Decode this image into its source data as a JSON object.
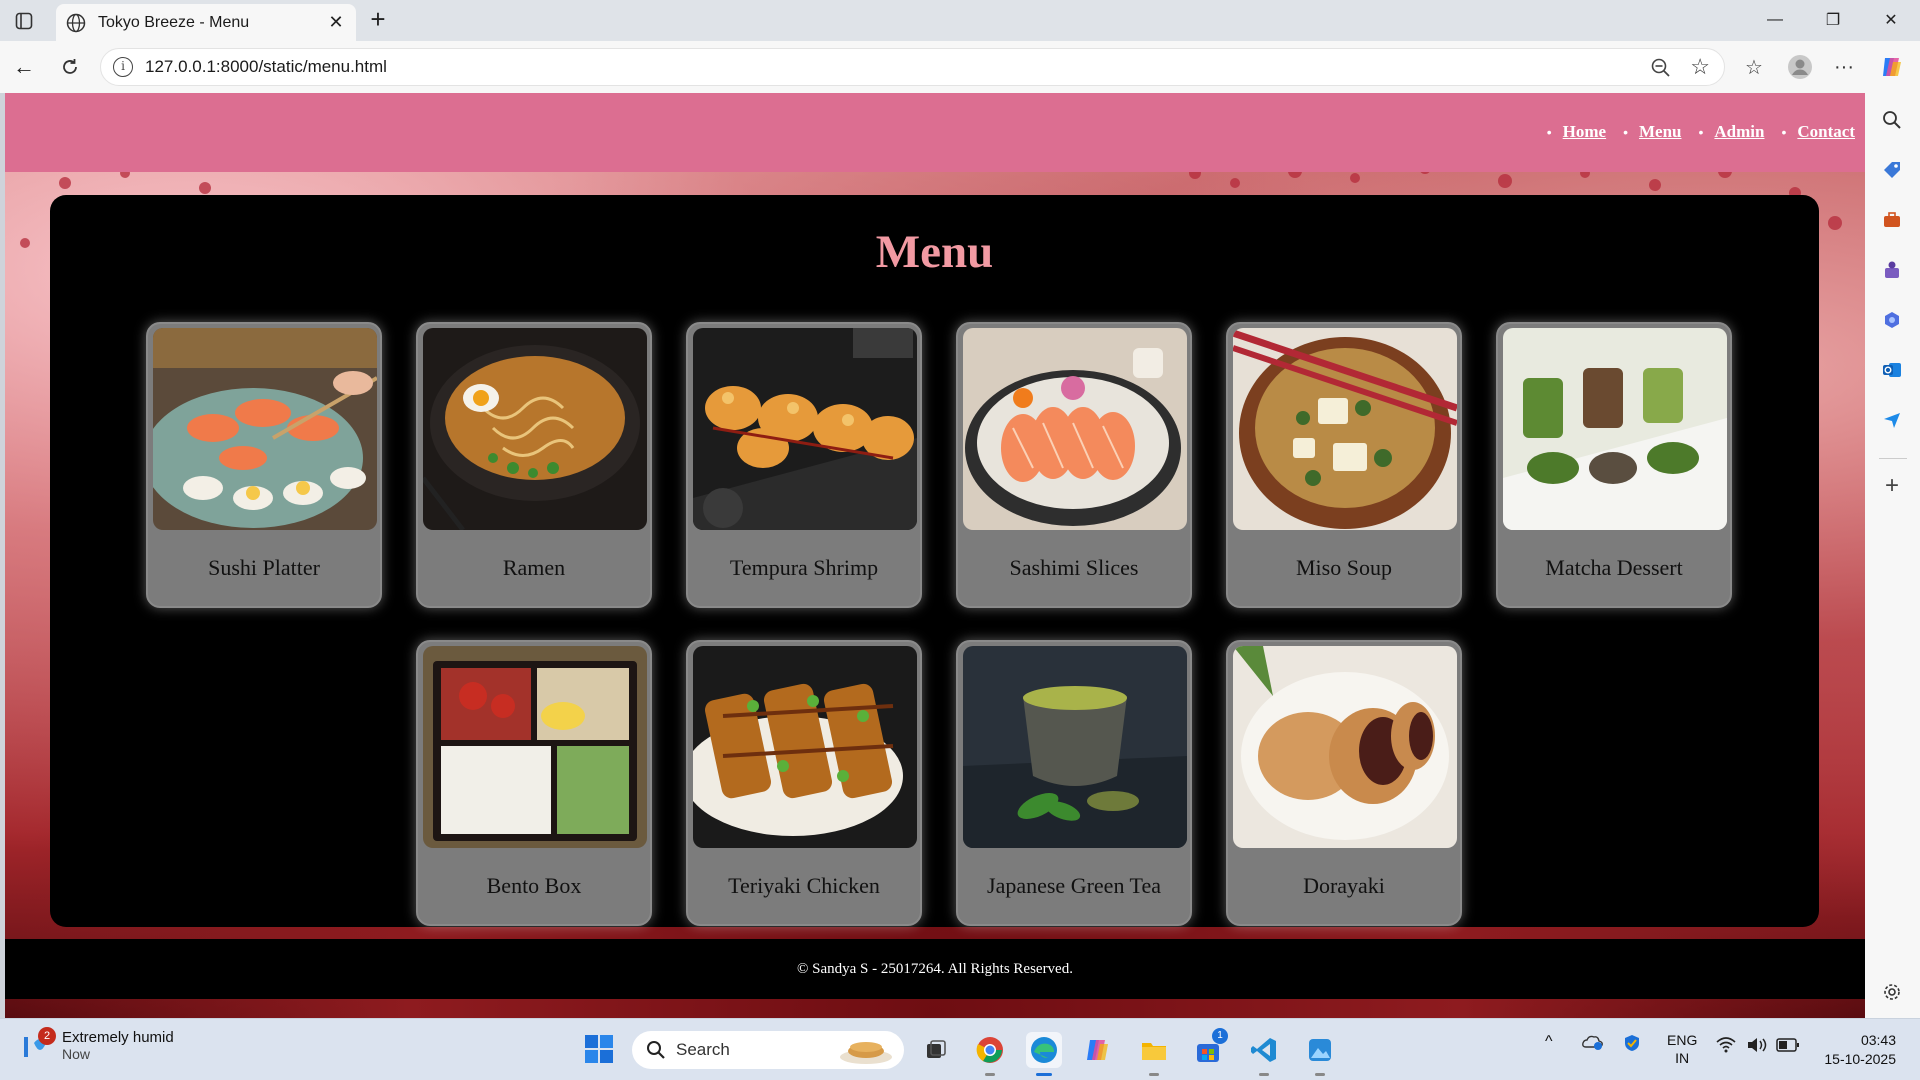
{
  "browser": {
    "tab_title": "Tokyo Breeze - Menu",
    "url": "127.0.0.1:8000/static/menu.html"
  },
  "site": {
    "nav": [
      "Home",
      "Menu",
      "Admin",
      "Contact"
    ],
    "title": "Menu",
    "items": [
      {
        "name": "Sushi Platter",
        "icon": "sushi-photo"
      },
      {
        "name": "Ramen",
        "icon": "ramen-photo"
      },
      {
        "name": "Tempura Shrimp",
        "icon": "tempura-photo"
      },
      {
        "name": "Sashimi Slices",
        "icon": "sashimi-photo"
      },
      {
        "name": "Miso Soup",
        "icon": "miso-photo"
      },
      {
        "name": "Matcha Dessert",
        "icon": "matcha-photo"
      },
      {
        "name": "Bento Box",
        "icon": "bento-photo"
      },
      {
        "name": "Teriyaki Chicken",
        "icon": "teriyaki-photo"
      },
      {
        "name": "Japanese Green Tea",
        "icon": "green-tea-photo"
      },
      {
        "name": "Dorayaki",
        "icon": "dorayaki-photo"
      }
    ],
    "footer": "© Sandya S - 25017264. All Rights Reserved.",
    "colors": {
      "header": "#dc6e91",
      "title": "#f29aa3",
      "panel": "#000000",
      "card": "#7c7c7c"
    }
  },
  "taskbar": {
    "weather_title": "Extremely humid",
    "weather_sub": "Now",
    "weather_badge": "2",
    "search_label": "Search",
    "store_badge": "1",
    "lang_line1": "ENG",
    "lang_line2": "IN",
    "time": "03:43",
    "date": "15-10-2025"
  }
}
